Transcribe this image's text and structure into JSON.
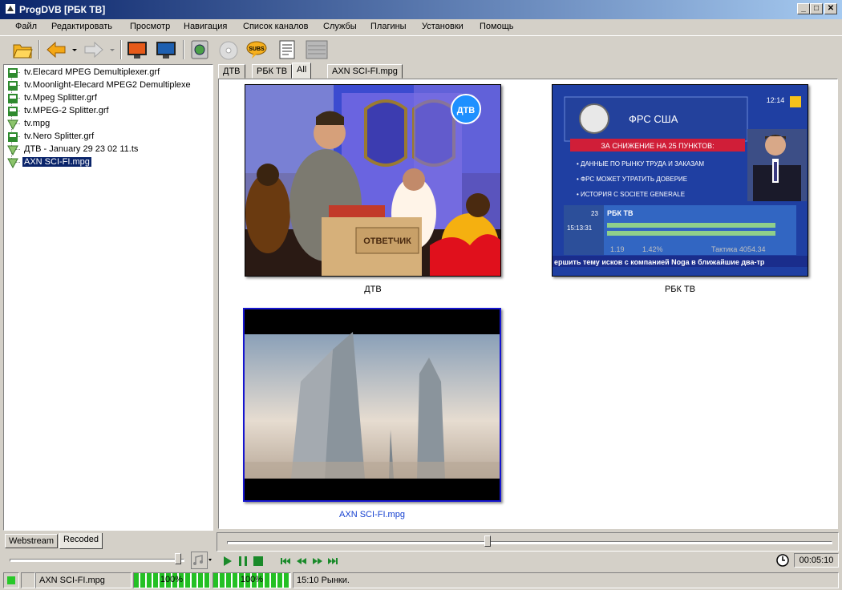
{
  "window": {
    "title": "ProgDVB [РБК ТВ]",
    "btn_min": "_",
    "btn_max": "□",
    "btn_close": "✕"
  },
  "menu": [
    "Файл",
    "Редактировать",
    "Просмотр",
    "Навигация",
    "Список каналов",
    "Службы",
    "Плагины",
    "Установки",
    "Помощь"
  ],
  "tree": [
    {
      "label": "tv.Elecard MPEG Demultiplexer.grf",
      "icon": "graph-file-icon"
    },
    {
      "label": "tv.Moonlight-Elecard MPEG2 Demultiplexe",
      "icon": "graph-file-icon"
    },
    {
      "label": "tv.Mpeg Splitter.grf",
      "icon": "graph-file-icon"
    },
    {
      "label": "tv.MPEG-2 Splitter.grf",
      "icon": "graph-file-icon"
    },
    {
      "label": "tv.mpg",
      "icon": "media-file-icon"
    },
    {
      "label": "tv.Nero Splitter.grf",
      "icon": "graph-file-icon"
    },
    {
      "label": "ДТВ - January 29 23 02 11.ts",
      "icon": "media-file-icon"
    },
    {
      "label": "AXN SCI-FI.mpg",
      "icon": "media-file-icon",
      "selected": true
    }
  ],
  "left_tabs": [
    "Webstream",
    "Recoded"
  ],
  "channel_tabs": [
    "ДТВ",
    "РБК ТВ",
    "All",
    "AXN SCI-FI.mpg"
  ],
  "active_channel_tab": "All",
  "thumbnails": [
    {
      "caption": "ДТВ",
      "logo": "ДТВ",
      "podium": "ОТВЕТЧИК"
    },
    {
      "caption": "РБК ТВ",
      "headline": "ФРС США",
      "banner": "ЗА СНИЖЕНИЕ НА 25 ПУНКТОВ:",
      "bullets": [
        "ДАННЫЕ ПО РЫНКУ ТРУДА И ЗАКАЗАМ",
        "ФРС МОЖЕТ УТРАТИТЬ ДОВЕРИЕ",
        "ИСТОРИЯ С SOCIETE GENERALE"
      ],
      "osd_channel": "РБК ТВ",
      "osd_num": "23",
      "osd_time": "15:13:31",
      "clock": "12:14",
      "ticker": "ершить тему исков с компанией Noga в ближайшие два-тр",
      "index_left": "1.19",
      "index_pct": "1.42%",
      "index_right": "Тактика 4054.34"
    },
    {
      "caption": "AXN SCI-FI.mpg"
    }
  ],
  "playback": {
    "position": 0.43,
    "volume": 1.0,
    "time": "00:05:10"
  },
  "status": {
    "channel": "AXN SCI-FI.mpg",
    "signal_level": "100%",
    "signal_quality": "100%",
    "epg": "15:10 Рынки."
  },
  "colors": {
    "title_start": "#0a246a",
    "title_end": "#a6caf0",
    "selection": "#0a246a",
    "progress": "#24c024",
    "link": "#1540d0"
  }
}
